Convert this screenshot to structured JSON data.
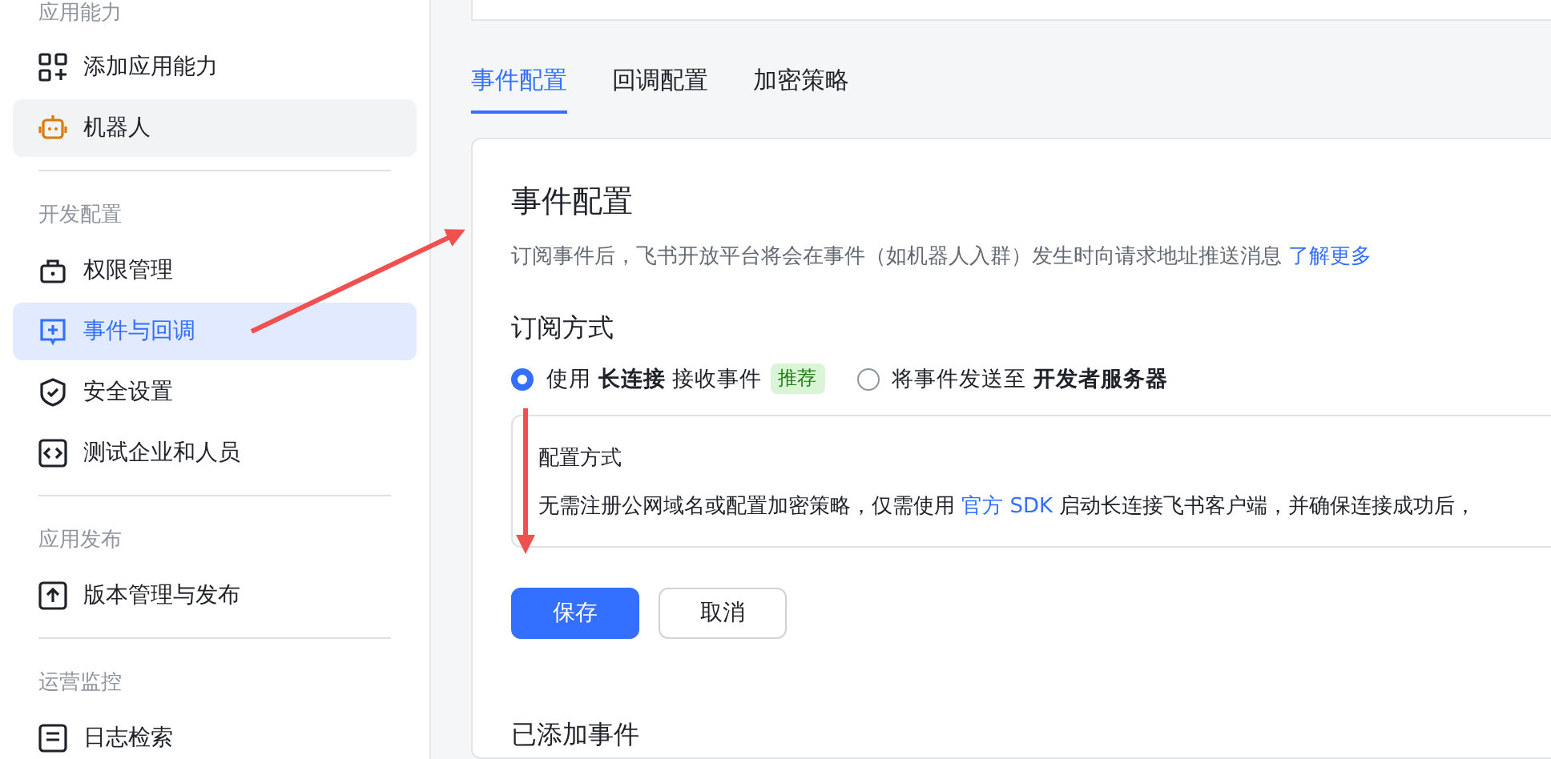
{
  "sidebar": {
    "groups": [
      {
        "title": "应用能力",
        "items": [
          {
            "label": "添加应用能力",
            "selected": false
          },
          {
            "label": "机器人",
            "selected": false,
            "hovered": true
          }
        ]
      },
      {
        "title": "开发配置",
        "items": [
          {
            "label": "权限管理",
            "selected": false
          },
          {
            "label": "事件与回调",
            "selected": true
          },
          {
            "label": "安全设置",
            "selected": false
          },
          {
            "label": "测试企业和人员",
            "selected": false
          }
        ]
      },
      {
        "title": "应用发布",
        "items": [
          {
            "label": "版本管理与发布",
            "selected": false
          }
        ]
      },
      {
        "title": "运营监控",
        "items": [
          {
            "label": "日志检索",
            "selected": false
          }
        ]
      }
    ]
  },
  "tabs": [
    {
      "label": "事件配置",
      "selected": true
    },
    {
      "label": "回调配置",
      "selected": false
    },
    {
      "label": "加密策略",
      "selected": false
    }
  ],
  "panel": {
    "title": "事件配置",
    "description": "订阅事件后，飞书开放平台将会在事件（如机器人入群）发生时向请求地址推送消息",
    "description_link": "了解更多",
    "subscription": {
      "title": "订阅方式",
      "options": [
        {
          "label": "使用 **长连接** 接收事件",
          "badge": "推荐",
          "selected": true
        },
        {
          "label": "将事件发送至 **开发者服务器**",
          "selected": false
        }
      ]
    },
    "config": {
      "title": "配置方式",
      "text_before": "无需注册公网域名或配置加密策略，仅需使用",
      "link": "官方 SDK",
      "text_after": "启动长连接飞书客户端，并确保连接成功后，"
    },
    "buttons": [
      {
        "label": "保存",
        "kind": "primary"
      },
      {
        "label": "取消",
        "kind": "default"
      }
    ],
    "added_events_title": "已添加事件"
  }
}
